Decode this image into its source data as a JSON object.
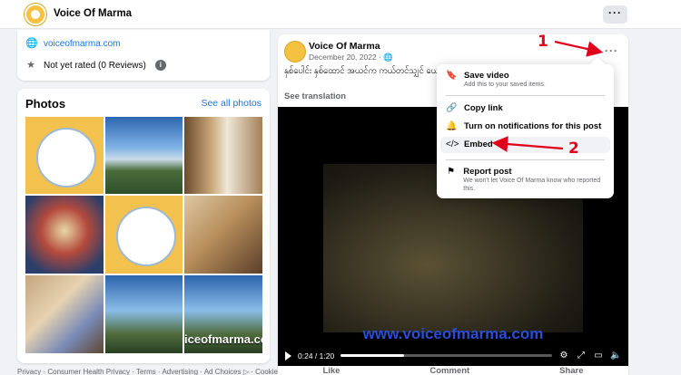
{
  "header": {
    "page_name": "Voice Of Marma",
    "more_button_label": "···"
  },
  "intro": {
    "website": "voiceofmarma.com",
    "rating": "Not yet rated (0 Reviews)",
    "info_badge": "i"
  },
  "photos": {
    "title": "Photos",
    "see_all": "See all photos",
    "caption_last": "iceofmarma.co"
  },
  "footer": {
    "links": "Privacy · Consumer Health Privacy · Terms · Advertising · Ad Choices ▷ · Cookies ·"
  },
  "post": {
    "author": "Voice Of Marma",
    "date": "December 20, 2022 · 🌐",
    "more": "···",
    "text": "နှစ်ပေါင်း နှစ်ထောင် အယင်က ကယ်တင်သျှင် ယေ... ဖွားခြင်း သရုပ်ဆောင် ဇာတ်ကားကို တင်ပြထားပါ...",
    "see_translation": "See translation",
    "video": {
      "url_overlay": "www.voiceofmarma.com",
      "time": "0:24 / 1:20",
      "progress": 0.3
    },
    "actions": [
      "Like",
      "Comment",
      "Share"
    ]
  },
  "menu": {
    "items": [
      {
        "icon": "bookmark-icon",
        "title": "Save video",
        "sub": "Add this to your saved items."
      },
      {
        "icon": "link-icon",
        "title": "Copy link",
        "sub": ""
      },
      {
        "icon": "bell-icon",
        "title": "Turn on notifications for this post",
        "sub": ""
      },
      {
        "icon": "code-icon",
        "title": "Embed",
        "sub": ""
      },
      {
        "icon": "report-icon",
        "title": "Report post",
        "sub": "We won't let Voice Of Marma know who reported this."
      }
    ]
  },
  "annotations": {
    "one": "1",
    "two": "2"
  },
  "colors": {
    "accent": "#1b74e4",
    "annotation": "#e0001b"
  }
}
